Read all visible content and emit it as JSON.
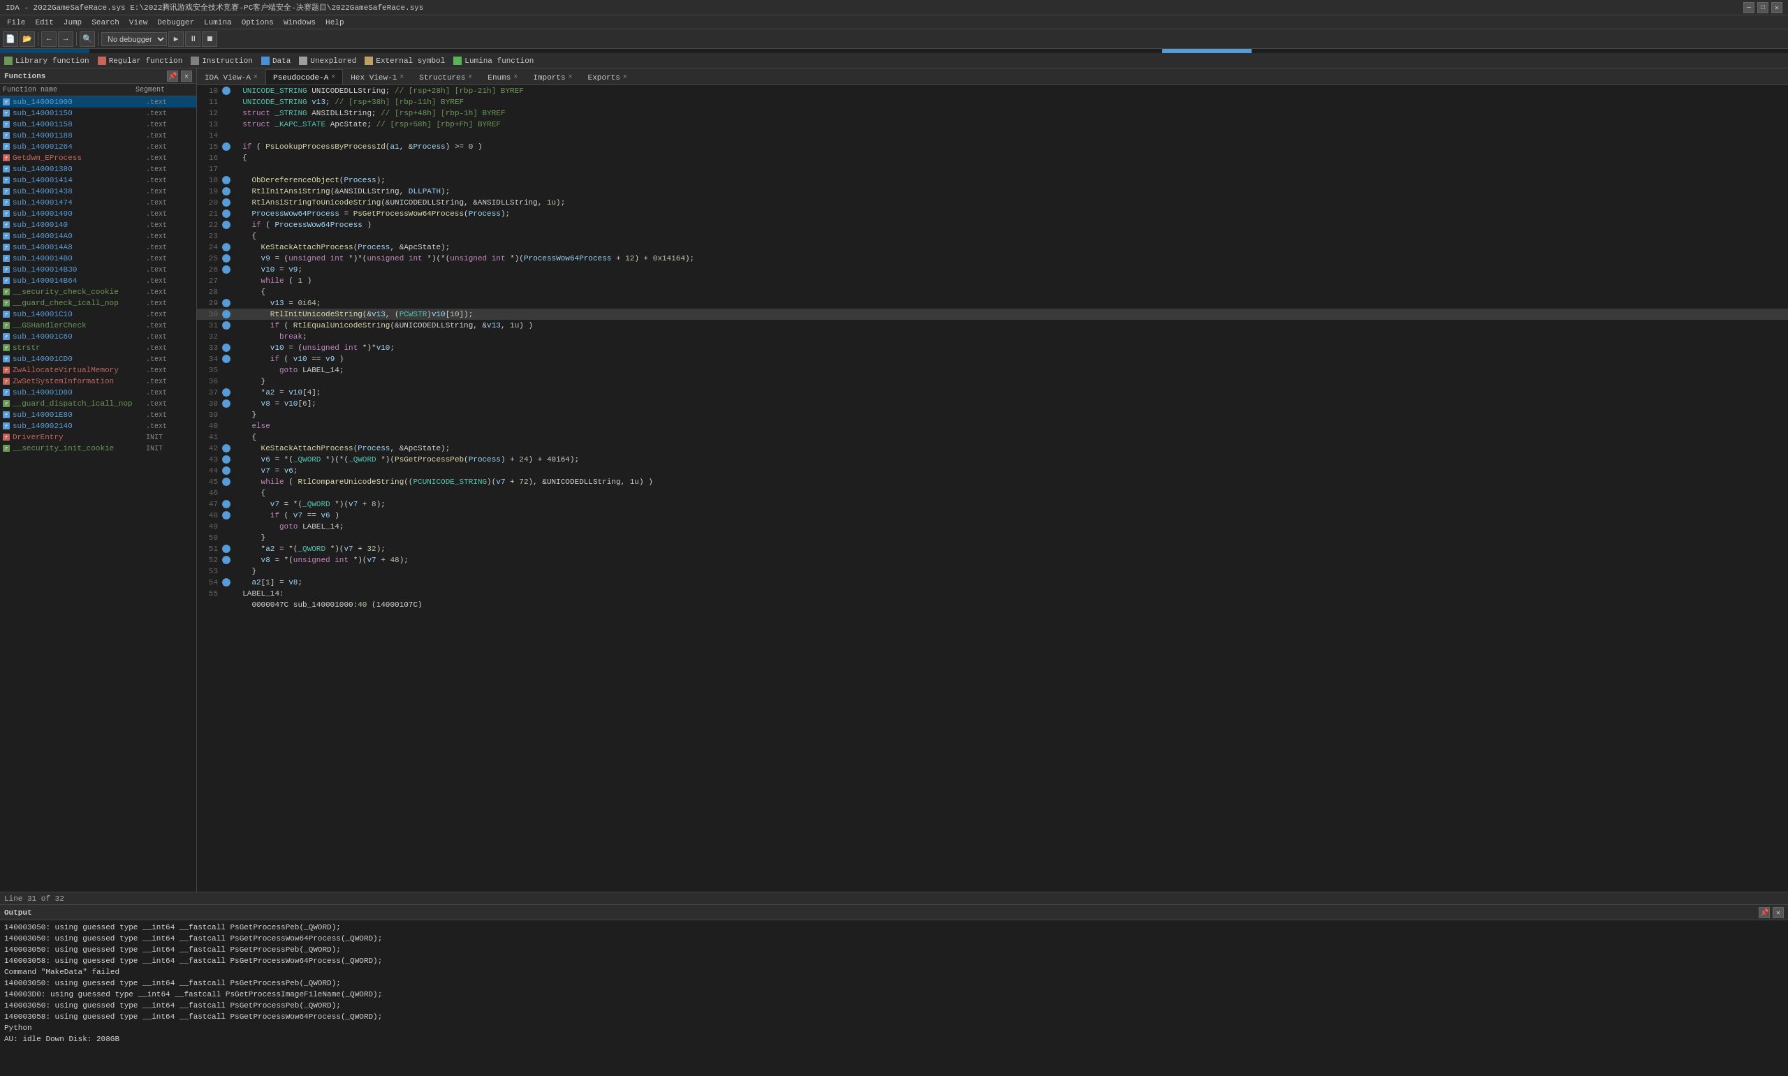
{
  "titleBar": {
    "text": "IDA - 2022GameSafeRace.sys E:\\2022腾讯游戏安全技术竞赛-PC客户端安全-决赛题目\\2022GameSafeRace.sys",
    "minimize": "—",
    "maximize": "□",
    "close": "✕"
  },
  "menuBar": {
    "items": [
      "File",
      "Edit",
      "Jump",
      "Search",
      "View",
      "Debugger",
      "Lumina",
      "Options",
      "Windows",
      "Help"
    ]
  },
  "legend": {
    "items": [
      {
        "color": "#6a9955",
        "label": "Library function"
      },
      {
        "color": "#c8645a",
        "label": "Regular function"
      },
      {
        "color": "#808080",
        "label": "Instruction"
      },
      {
        "color": "#4a90d9",
        "label": "Data"
      },
      {
        "color": "#9e9e9e",
        "label": "Unexplored"
      },
      {
        "color": "#c0a060",
        "label": "External symbol"
      },
      {
        "color": "#56b656",
        "label": "Lumina function"
      }
    ]
  },
  "functionsPanel": {
    "title": "Functions",
    "columns": [
      "Function name",
      "Segment"
    ],
    "functions": [
      {
        "name": "sub_140001000",
        "seg": ".text",
        "color": "#569cd6"
      },
      {
        "name": "sub_140001150",
        "seg": ".text",
        "color": "#569cd6"
      },
      {
        "name": "sub_140001158",
        "seg": ".text",
        "color": "#569cd6"
      },
      {
        "name": "sub_140001188",
        "seg": ".text",
        "color": "#569cd6"
      },
      {
        "name": "sub_140001264",
        "seg": ".text",
        "color": "#569cd6"
      },
      {
        "name": "Getdwm_EProcess",
        "seg": ".text",
        "color": "#c8645a"
      },
      {
        "name": "sub_140001380",
        "seg": ".text",
        "color": "#569cd6"
      },
      {
        "name": "sub_140001414",
        "seg": ".text",
        "color": "#569cd6"
      },
      {
        "name": "sub_140001438",
        "seg": ".text",
        "color": "#569cd6"
      },
      {
        "name": "sub_140001474",
        "seg": ".text",
        "color": "#569cd6"
      },
      {
        "name": "sub_140001490",
        "seg": ".text",
        "color": "#569cd6"
      },
      {
        "name": "sub_14000140",
        "seg": ".text",
        "color": "#569cd6"
      },
      {
        "name": "sub_1400014A0",
        "seg": ".text",
        "color": "#569cd6"
      },
      {
        "name": "sub_1400014A8",
        "seg": ".text",
        "color": "#569cd6"
      },
      {
        "name": "sub_1400014B0",
        "seg": ".text",
        "color": "#569cd6"
      },
      {
        "name": "sub_1400014B30",
        "seg": ".text",
        "color": "#569cd6"
      },
      {
        "name": "sub_1400014B64",
        "seg": ".text",
        "color": "#569cd6"
      },
      {
        "name": "__security_check_cookie",
        "seg": ".text",
        "color": "#6a9955"
      },
      {
        "name": "__guard_check_icall_nop",
        "seg": ".text",
        "color": "#6a9955"
      },
      {
        "name": "sub_140001C10",
        "seg": ".text",
        "color": "#569cd6"
      },
      {
        "name": "__GSHandlerCheck",
        "seg": ".text",
        "color": "#6a9955"
      },
      {
        "name": "sub_140001C60",
        "seg": ".text",
        "color": "#569cd6"
      },
      {
        "name": "strstr",
        "seg": ".text",
        "color": "#6a9955"
      },
      {
        "name": "sub_140001CD0",
        "seg": ".text",
        "color": "#569cd6"
      },
      {
        "name": "ZwAllocateVirtualMemory",
        "seg": ".text",
        "color": "#c8645a"
      },
      {
        "name": "ZwSetSystemInformation",
        "seg": ".text",
        "color": "#c8645a"
      },
      {
        "name": "sub_140001D80",
        "seg": ".text",
        "color": "#569cd6"
      },
      {
        "name": "__guard_dispatch_icall_nop",
        "seg": ".text",
        "color": "#6a9955"
      },
      {
        "name": "sub_140001E80",
        "seg": ".text",
        "color": "#569cd6"
      },
      {
        "name": "sub_140002140",
        "seg": ".text",
        "color": "#569cd6"
      },
      {
        "name": "DriverEntry",
        "seg": "INIT",
        "color": "#c8645a"
      },
      {
        "name": "__security_init_cookie",
        "seg": "INIT",
        "color": "#6a9955"
      }
    ]
  },
  "tabs": [
    {
      "label": "IDA View-A",
      "active": false,
      "closeable": true
    },
    {
      "label": "Pseudocode-A",
      "active": true,
      "closeable": true
    },
    {
      "label": "Hex View-1",
      "active": false,
      "closeable": true
    },
    {
      "label": "Structures",
      "active": false,
      "closeable": true
    },
    {
      "label": "Enums",
      "active": false,
      "closeable": true
    },
    {
      "label": "Imports",
      "active": false,
      "closeable": true
    },
    {
      "label": "Exports",
      "active": false,
      "closeable": true
    }
  ],
  "codeLines": [
    {
      "num": "10",
      "dot": "blue",
      "text": "  UNICODE_STRING UNICODEDLLString; // [rsp+28h] [rbp-21h] BYREF"
    },
    {
      "num": "11",
      "dot": "empty",
      "text": "  UNICODE_STRING v13; // [rsp+38h] [rbp-11h] BYREF"
    },
    {
      "num": "12",
      "dot": "empty",
      "text": "  struct _STRING ANSIDLLString; // [rsp+48h] [rbp-1h] BYREF"
    },
    {
      "num": "13",
      "dot": "empty",
      "text": "  struct _KAPC_STATE ApcState; // [rsp+58h] [rbp+Fh] BYREF"
    },
    {
      "num": "14",
      "dot": "empty",
      "text": ""
    },
    {
      "num": "15",
      "dot": "blue",
      "text": "  if ( PsLookupProcessByProcessId(a1, &Process) >= 0 )"
    },
    {
      "num": "16",
      "dot": "empty",
      "text": "  {"
    },
    {
      "num": "17",
      "dot": "empty",
      "text": ""
    },
    {
      "num": "18",
      "dot": "blue",
      "text": "    ObDereferenceObject(Process);"
    },
    {
      "num": "19",
      "dot": "blue",
      "text": "    RtlInitAnsiString(&ANSIDLLString, DLLPATH);"
    },
    {
      "num": "20",
      "dot": "blue",
      "text": "    RtlAnsiStringToUnicodeString(&UNICODEDLLString, &ANSIDLLString, 1u);"
    },
    {
      "num": "21",
      "dot": "blue",
      "text": "    ProcessWow64Process = PsGetProcessWow64Process(Process);"
    },
    {
      "num": "22",
      "dot": "blue",
      "text": "    if ( ProcessWow64Process )"
    },
    {
      "num": "23",
      "dot": "empty",
      "text": "    {"
    },
    {
      "num": "24",
      "dot": "blue",
      "text": "      KeStackAttachProcess(Process, &ApcState);"
    },
    {
      "num": "25",
      "dot": "blue",
      "text": "      v9 = (unsigned int *)*(unsigned int *)(*(unsigned int *)(ProcessWow64Process + 12) + 0x14i64);"
    },
    {
      "num": "26",
      "dot": "blue",
      "text": "      v10 = v9;"
    },
    {
      "num": "27",
      "dot": "empty",
      "text": "      while ( 1 )"
    },
    {
      "num": "28",
      "dot": "empty",
      "text": "      {"
    },
    {
      "num": "29",
      "dot": "blue",
      "text": "        v13 = 0i64;"
    },
    {
      "num": "30",
      "dot": "blue",
      "text": "        RtlInitUnicodeString(&v13, (PCWSTR)v10[10]);"
    },
    {
      "num": "31",
      "dot": "blue",
      "text": "        if ( RtlEqualUnicodeString(&UNICODEDLLString, &v13, 1u) )"
    },
    {
      "num": "32",
      "dot": "empty",
      "text": "          break;"
    },
    {
      "num": "33",
      "dot": "blue",
      "text": "        v10 = (unsigned int *)*v10;"
    },
    {
      "num": "34",
      "dot": "blue",
      "text": "        if ( v10 == v9 )"
    },
    {
      "num": "35",
      "dot": "empty",
      "text": "          goto LABEL_14;"
    },
    {
      "num": "36",
      "dot": "empty",
      "text": "      }"
    },
    {
      "num": "37",
      "dot": "blue",
      "text": "      *a2 = v10[4];"
    },
    {
      "num": "38",
      "dot": "blue",
      "text": "      v8 = v10[6];"
    },
    {
      "num": "39",
      "dot": "empty",
      "text": "    }"
    },
    {
      "num": "40",
      "dot": "empty",
      "text": "    else"
    },
    {
      "num": "41",
      "dot": "empty",
      "text": "    {"
    },
    {
      "num": "42",
      "dot": "blue",
      "text": "      KeStackAttachProcess(Process, &ApcState);"
    },
    {
      "num": "43",
      "dot": "blue",
      "text": "      v6 = *(_QWORD *)(*(_QWORD *)(PsGetProcessPeb(Process) + 24) + 40i64);"
    },
    {
      "num": "44",
      "dot": "blue",
      "text": "      v7 = v6;"
    },
    {
      "num": "45",
      "dot": "blue",
      "text": "      while ( RtlCompareUnicodeString((PCUNICODE_STRING)(v7 + 72), &UNICODEDLLString, 1u) )"
    },
    {
      "num": "46",
      "dot": "empty",
      "text": "      {"
    },
    {
      "num": "47",
      "dot": "blue",
      "text": "        v7 = *(_QWORD *)(v7 + 8);"
    },
    {
      "num": "48",
      "dot": "blue",
      "text": "        if ( v7 == v6 )"
    },
    {
      "num": "49",
      "dot": "empty",
      "text": "          goto LABEL_14;"
    },
    {
      "num": "50",
      "dot": "empty",
      "text": "      }"
    },
    {
      "num": "51",
      "dot": "blue",
      "text": "      *a2 = *(_QWORD *)(v7 + 32);"
    },
    {
      "num": "52",
      "dot": "blue",
      "text": "      v8 = *(unsigned int *)(v7 + 48);"
    },
    {
      "num": "53",
      "dot": "empty",
      "text": "    }"
    },
    {
      "num": "54",
      "dot": "blue",
      "text": "    a2[1] = v8;"
    },
    {
      "num": "55",
      "dot": "empty",
      "text": "  LABEL_14:"
    },
    {
      "num": "",
      "dot": "empty",
      "text": "    0000047C sub_140001000:40 (14000107C)"
    }
  ],
  "lineStatus": "Line 31 of 32",
  "outputPanel": {
    "title": "Output",
    "lines": [
      "140003050: using guessed type __int64 __fastcall PsGetProcessPeb(_QWORD);",
      "140003050: using guessed type __int64 __fastcall PsGetProcessWow64Process(_QWORD);",
      "140003050: using guessed type __int64 __fastcall PsGetProcessPeb(_QWORD);",
      "140003058: using guessed type __int64 __fastcall PsGetProcessWow64Process(_QWORD);",
      "Command \"MakeData\" failed",
      "140003050: using guessed type __int64 __fastcall PsGetProcessPeb(_QWORD);",
      "140003D0: using guessed type __int64 __fastcall PsGetProcessImageFileName(_QWORD);",
      "140003050: using guessed type __int64 __fastcall PsGetProcessPeb(_QWORD);",
      "140003058: using guessed type __int64 __fastcall PsGetProcessWow64Process(_QWORD);",
      "Python",
      "AU: idle  Down  Disk: 208GB"
    ]
  },
  "statusBar": {
    "lineInfo": "AU: idle",
    "direction": "Down",
    "disk": "Disk: 208GB"
  },
  "debugger": {
    "placeholder": "No debugger"
  }
}
